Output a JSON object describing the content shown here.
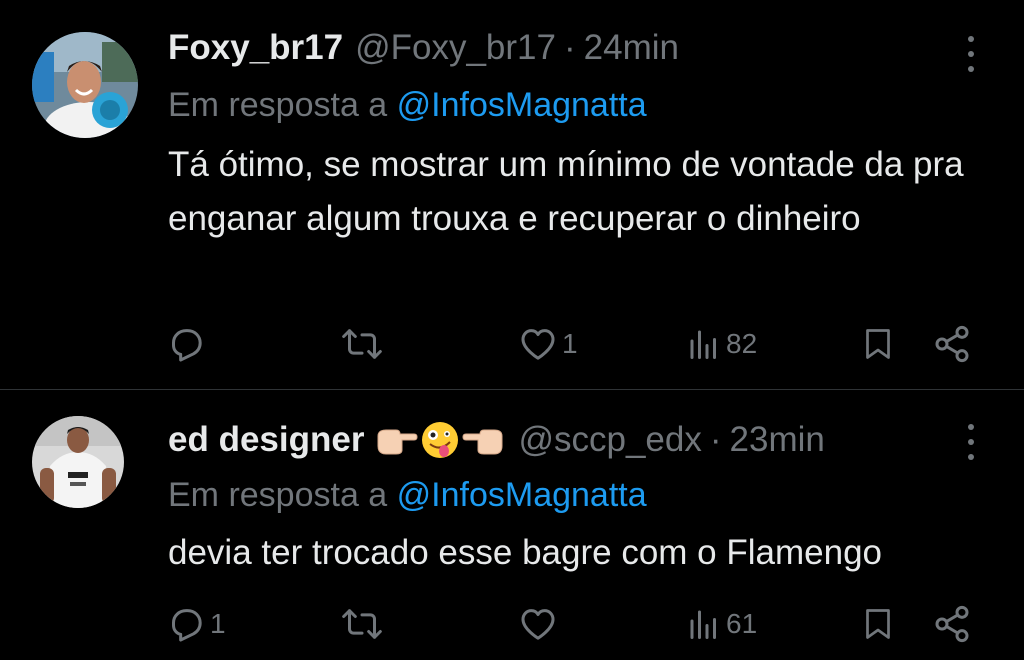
{
  "tweets": [
    {
      "display_name": "Foxy_br17",
      "handle": "@Foxy_br17",
      "separator": "·",
      "time": "24min",
      "reply_prefix": "Em resposta a ",
      "reply_to": "@InfosMagnatta",
      "text": "Tá ótimo, se mostrar um mínimo de vontade da pra enganar algum trouxa e recuperar o dinheiro",
      "replies": "",
      "retweets": "",
      "likes": "1",
      "views": "82",
      "name_emojis": []
    },
    {
      "display_name": "ed designer",
      "handle": "@sccp_edx",
      "separator": "·",
      "time": "23min",
      "reply_prefix": "Em resposta a ",
      "reply_to": "@InfosMagnatta",
      "text": "devia ter trocado esse bagre com o Flamengo",
      "replies": "1",
      "retweets": "",
      "likes": "",
      "views": "61",
      "name_emojis": [
        "pointing-right-hand",
        "zany-face",
        "pointing-left-hand"
      ]
    }
  ],
  "colors": {
    "background": "#000000",
    "text": "#e7e9ea",
    "muted": "#71767b",
    "link": "#1d9bf0",
    "divider": "#2f3336"
  }
}
